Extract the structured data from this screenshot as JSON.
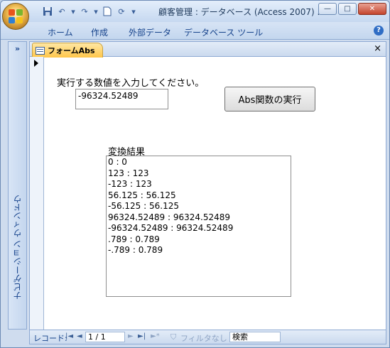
{
  "window": {
    "title": "顧客管理 : データベース (Access 2007) ..."
  },
  "ribbon": {
    "tabs": [
      "ホーム",
      "作成",
      "外部データ",
      "データベース ツール"
    ]
  },
  "nav_pane": {
    "toggle": "»",
    "label": "ナビゲーション ウィンドウ"
  },
  "document": {
    "tab_title": "フォームAbs",
    "close": "×"
  },
  "form": {
    "prompt": "実行する数値を入力してください。",
    "input_value": "-96324.52489",
    "button_label": "Abs関数の実行",
    "result_label": "変換結果",
    "results": [
      "0 : 0",
      "123 : 123",
      "-123 : 123",
      "56.125 : 56.125",
      "-56.125 : 56.125",
      "96324.52489 : 96324.52489",
      "-96324.52489 : 96324.52489",
      ".789 : 0.789",
      "-.789 : 0.789"
    ]
  },
  "record_nav": {
    "label": "レコード:",
    "current": "1 / 1",
    "filter": "フィルタなし",
    "search": "検索"
  },
  "colors": {
    "doc_tab": "#ffc64a",
    "chrome": "#cfdcee",
    "accent": "#15428b"
  }
}
